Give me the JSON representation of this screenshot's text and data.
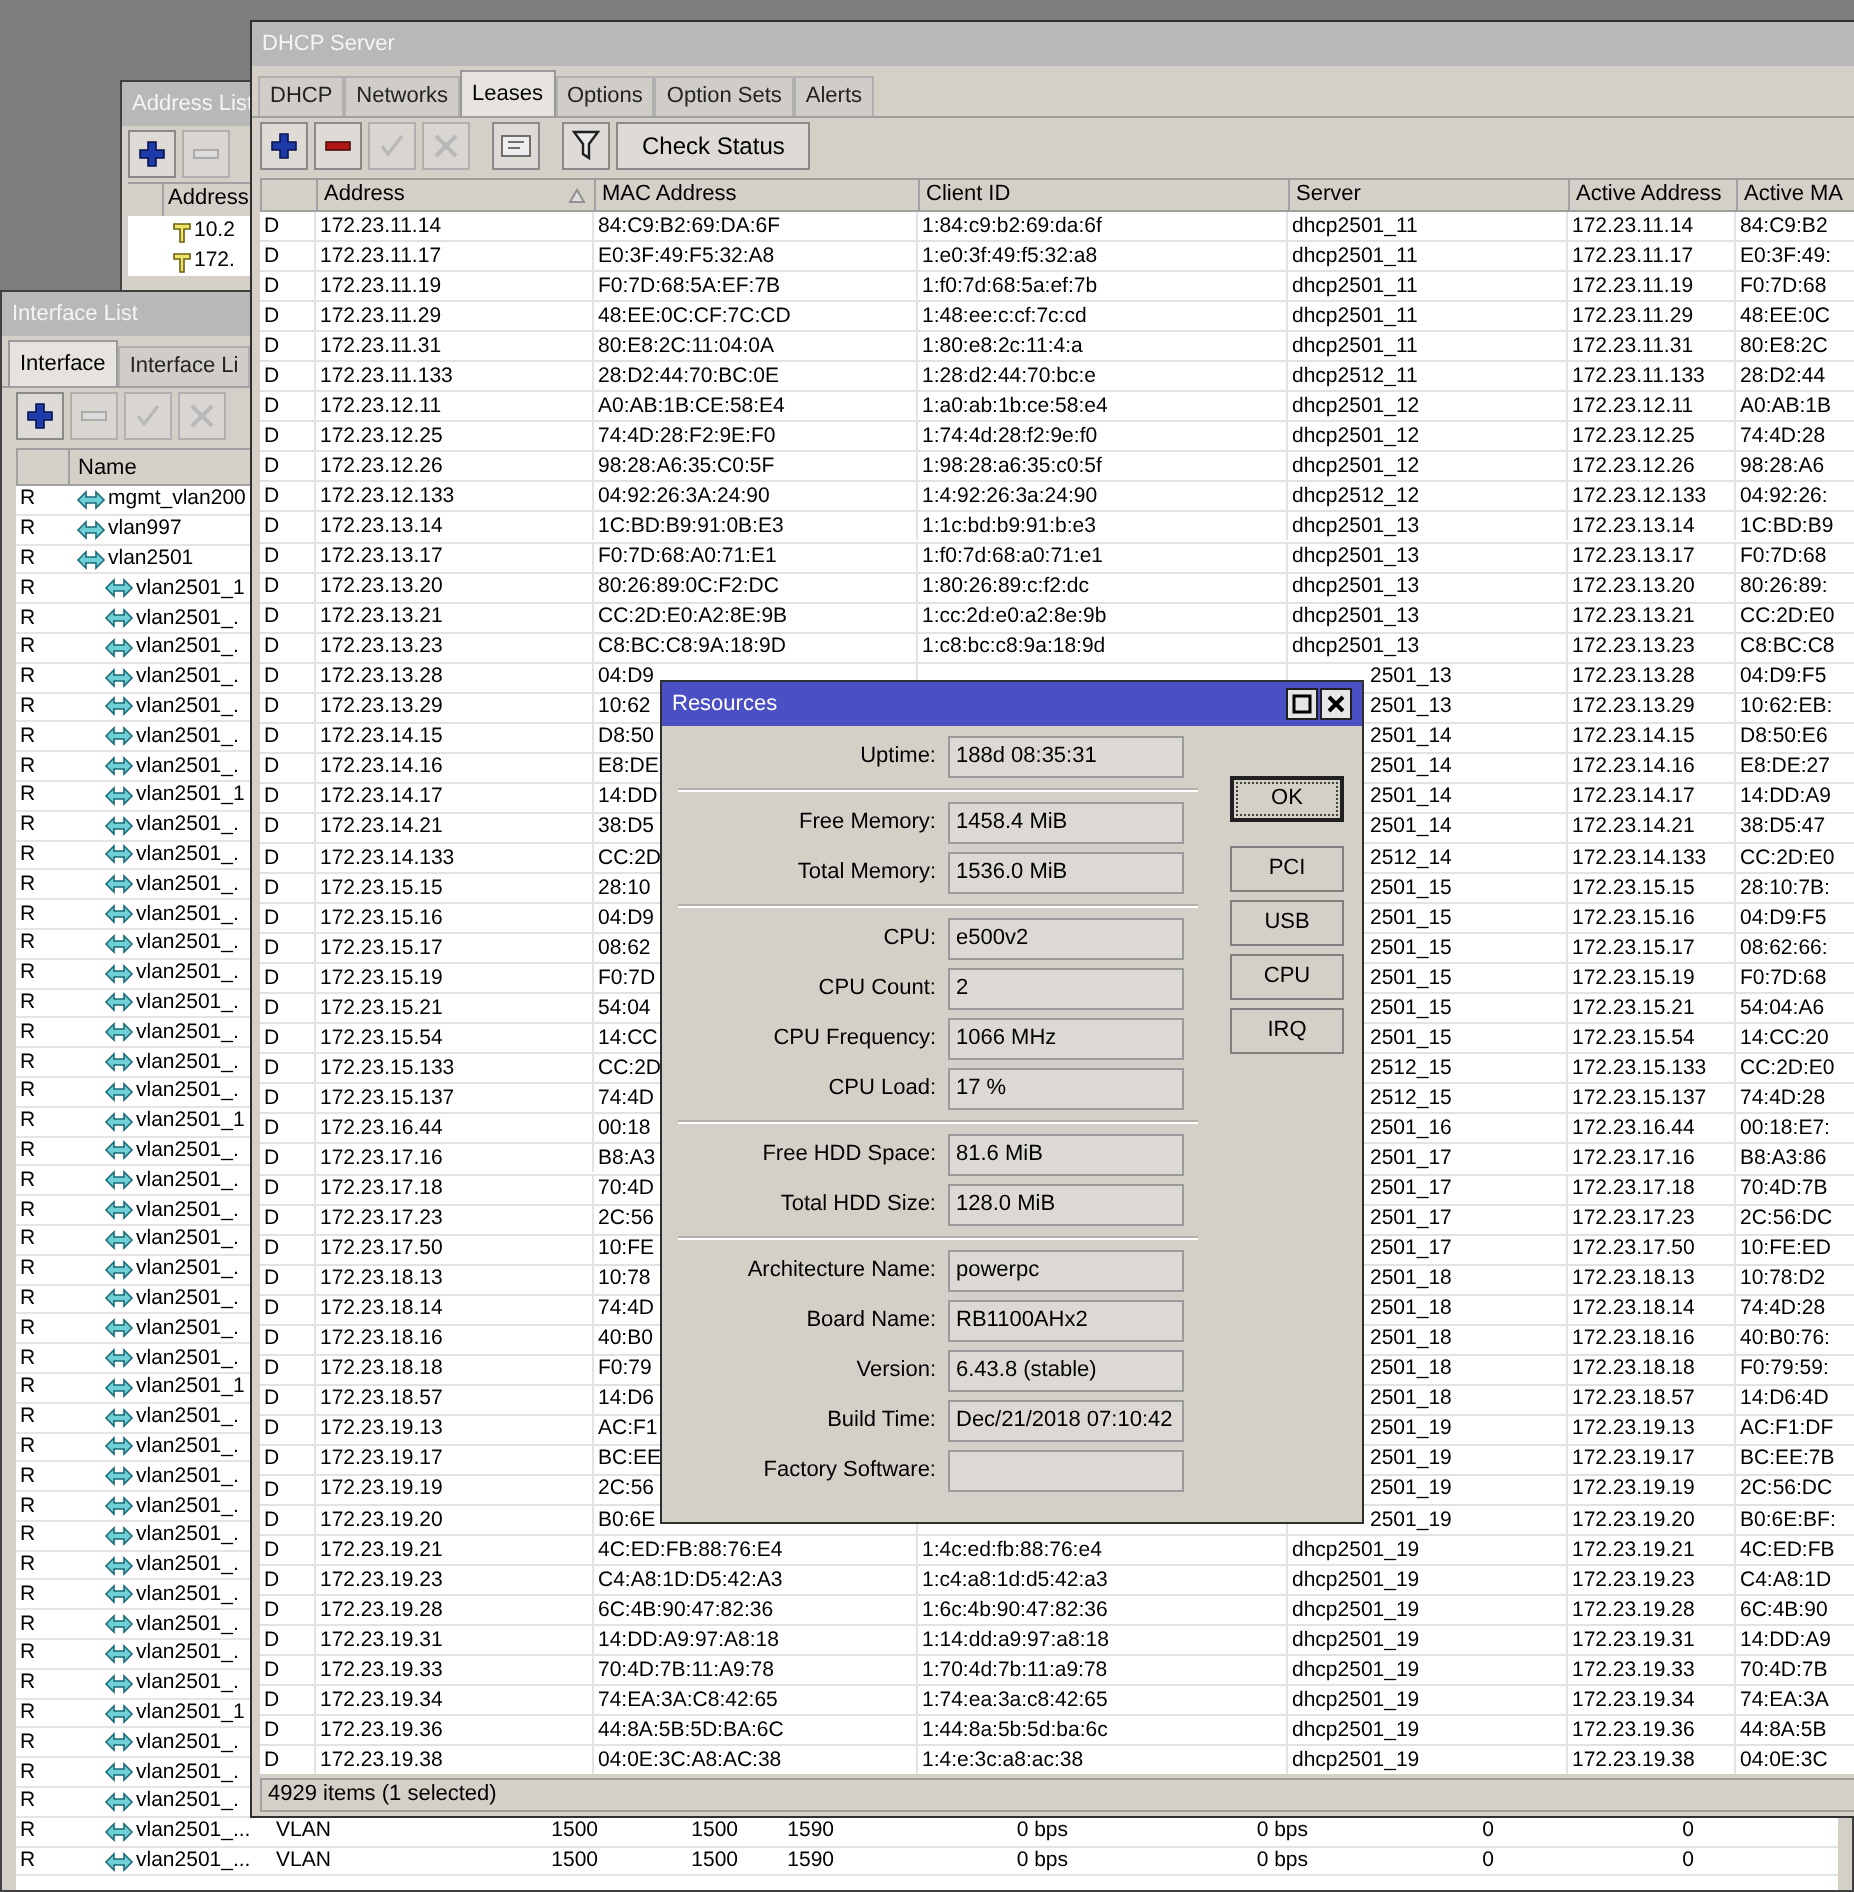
{
  "address_list_window": {
    "title": "Address List",
    "toolbar": [
      {
        "kind": "add",
        "disabled": false
      },
      {
        "kind": "remove",
        "disabled": true
      }
    ],
    "columns": [
      "Address"
    ],
    "rows": [
      "10.2",
      "172."
    ]
  },
  "interface_list_window": {
    "title": "Interface List",
    "tabs": [
      {
        "label": "Interface",
        "selected": true
      },
      {
        "label": "Interface Li",
        "selected": false
      }
    ],
    "toolbar": [
      {
        "kind": "add",
        "disabled": false
      },
      {
        "kind": "remove",
        "disabled": true
      },
      {
        "kind": "enable",
        "disabled": true
      },
      {
        "kind": "disable",
        "disabled": true
      }
    ],
    "columns": [
      "Name"
    ],
    "rows": [
      {
        "flag": "R",
        "name": "mgmt_vlan200"
      },
      {
        "flag": "R",
        "name": "vlan997"
      },
      {
        "flag": "R",
        "name": "vlan2501",
        "children": [
          {
            "flag": "R",
            "name": "vlan2501_1"
          },
          {
            "flag": "R",
            "name": "vlan2501_."
          },
          {
            "flag": "R",
            "name": "vlan2501_."
          },
          {
            "flag": "R",
            "name": "vlan2501_."
          },
          {
            "flag": "R",
            "name": "vlan2501_."
          },
          {
            "flag": "R",
            "name": "vlan2501_."
          },
          {
            "flag": "R",
            "name": "vlan2501_."
          },
          {
            "flag": "R",
            "name": "vlan2501_1"
          },
          {
            "flag": "R",
            "name": "vlan2501_."
          },
          {
            "flag": "R",
            "name": "vlan2501_."
          },
          {
            "flag": "R",
            "name": "vlan2501_."
          },
          {
            "flag": "R",
            "name": "vlan2501_."
          },
          {
            "flag": "R",
            "name": "vlan2501_."
          },
          {
            "flag": "R",
            "name": "vlan2501_."
          },
          {
            "flag": "R",
            "name": "vlan2501_."
          },
          {
            "flag": "R",
            "name": "vlan2501_."
          },
          {
            "flag": "R",
            "name": "vlan2501_."
          },
          {
            "flag": "R",
            "name": "vlan2501_."
          },
          {
            "flag": "R",
            "name": "vlan2501_1"
          },
          {
            "flag": "R",
            "name": "vlan2501_."
          },
          {
            "flag": "R",
            "name": "vlan2501_."
          },
          {
            "flag": "R",
            "name": "vlan2501_."
          },
          {
            "flag": "R",
            "name": "vlan2501_."
          },
          {
            "flag": "R",
            "name": "vlan2501_."
          },
          {
            "flag": "R",
            "name": "vlan2501_."
          },
          {
            "flag": "R",
            "name": "vlan2501_."
          },
          {
            "flag": "R",
            "name": "vlan2501_."
          },
          {
            "flag": "R",
            "name": "vlan2501_1"
          },
          {
            "flag": "R",
            "name": "vlan2501_."
          },
          {
            "flag": "R",
            "name": "vlan2501_."
          },
          {
            "flag": "R",
            "name": "vlan2501_."
          },
          {
            "flag": "R",
            "name": "vlan2501_."
          },
          {
            "flag": "R",
            "name": "vlan2501_."
          },
          {
            "flag": "R",
            "name": "vlan2501_."
          },
          {
            "flag": "R",
            "name": "vlan2501_."
          },
          {
            "flag": "R",
            "name": "vlan2501_."
          },
          {
            "flag": "R",
            "name": "vlan2501_."
          },
          {
            "flag": "R",
            "name": "vlan2501_."
          },
          {
            "flag": "R",
            "name": "vlan2501_1"
          },
          {
            "flag": "R",
            "name": "vlan2501_."
          },
          {
            "flag": "R",
            "name": "vlan2501_."
          },
          {
            "flag": "R",
            "name": "vlan2501_."
          },
          {
            "flag": "R",
            "name": "vlan2501_...",
            "cells": [
              "VLAN",
              "1500",
              "1500",
              "1590",
              "0 bps",
              "0 bps",
              "0",
              "0"
            ]
          },
          {
            "flag": "R",
            "name": "vlan2501_...",
            "cells": [
              "VLAN",
              "1500",
              "1500",
              "1590",
              "0 bps",
              "0 bps",
              "0",
              "0"
            ]
          }
        ]
      }
    ]
  },
  "dhcp_window": {
    "title": "DHCP Server",
    "tabs": [
      {
        "label": "DHCP",
        "selected": false
      },
      {
        "label": "Networks",
        "selected": false
      },
      {
        "label": "Leases",
        "selected": true
      },
      {
        "label": "Options",
        "selected": false
      },
      {
        "label": "Option Sets",
        "selected": false
      },
      {
        "label": "Alerts",
        "selected": false
      }
    ],
    "toolbar": [
      {
        "kind": "add",
        "disabled": false
      },
      {
        "kind": "remove",
        "disabled": false
      },
      {
        "kind": "enable",
        "disabled": true
      },
      {
        "kind": "disable",
        "disabled": true
      },
      {
        "kind": "comment",
        "disabled": false
      },
      {
        "kind": "filter",
        "disabled": false
      },
      {
        "kind": "text",
        "label": "Check Status",
        "disabled": false
      }
    ],
    "columns": [
      {
        "label": "Address",
        "sorted": true
      },
      {
        "label": "MAC Address",
        "sorted": false
      },
      {
        "label": "Client ID",
        "sorted": false
      },
      {
        "label": "Server",
        "sorted": false
      },
      {
        "label": "Active Address",
        "sorted": false
      },
      {
        "label": "Active MA",
        "sorted": false
      }
    ],
    "rows": [
      {
        "kind": "full",
        "flag": "D",
        "address": "172.23.11.14",
        "mac": "84:C9:B2:69:DA:6F",
        "client_id": "1:84:c9:b2:69:da:6f",
        "server": "dhcp2501_11",
        "active_address": "172.23.11.14",
        "active_mac": "84:C9:B2"
      },
      {
        "kind": "full",
        "flag": "D",
        "address": "172.23.11.17",
        "mac": "E0:3F:49:F5:32:A8",
        "client_id": "1:e0:3f:49:f5:32:a8",
        "server": "dhcp2501_11",
        "active_address": "172.23.11.17",
        "active_mac": "E0:3F:49:"
      },
      {
        "kind": "full",
        "flag": "D",
        "address": "172.23.11.19",
        "mac": "F0:7D:68:5A:EF:7B",
        "client_id": "1:f0:7d:68:5a:ef:7b",
        "server": "dhcp2501_11",
        "active_address": "172.23.11.19",
        "active_mac": "F0:7D:68"
      },
      {
        "kind": "full",
        "flag": "D",
        "address": "172.23.11.29",
        "mac": "48:EE:0C:CF:7C:CD",
        "client_id": "1:48:ee:c:cf:7c:cd",
        "server": "dhcp2501_11",
        "active_address": "172.23.11.29",
        "active_mac": "48:EE:0C"
      },
      {
        "kind": "full",
        "flag": "D",
        "address": "172.23.11.31",
        "mac": "80:E8:2C:11:04:0A",
        "client_id": "1:80:e8:2c:11:4:a",
        "server": "dhcp2501_11",
        "active_address": "172.23.11.31",
        "active_mac": "80:E8:2C"
      },
      {
        "kind": "full",
        "flag": "D",
        "address": "172.23.11.133",
        "mac": "28:D2:44:70:BC:0E",
        "client_id": "1:28:d2:44:70:bc:e",
        "server": "dhcp2512_11",
        "active_address": "172.23.11.133",
        "active_mac": "28:D2:44"
      },
      {
        "kind": "full",
        "flag": "D",
        "address": "172.23.12.11",
        "mac": "A0:AB:1B:CE:58:E4",
        "client_id": "1:a0:ab:1b:ce:58:e4",
        "server": "dhcp2501_12",
        "active_address": "172.23.12.11",
        "active_mac": "A0:AB:1B"
      },
      {
        "kind": "full",
        "flag": "D",
        "address": "172.23.12.25",
        "mac": "74:4D:28:F2:9E:F0",
        "client_id": "1:74:4d:28:f2:9e:f0",
        "server": "dhcp2501_12",
        "active_address": "172.23.12.25",
        "active_mac": "74:4D:28"
      },
      {
        "kind": "full",
        "flag": "D",
        "address": "172.23.12.26",
        "mac": "98:28:A6:35:C0:5F",
        "client_id": "1:98:28:a6:35:c0:5f",
        "server": "dhcp2501_12",
        "active_address": "172.23.12.26",
        "active_mac": "98:28:A6"
      },
      {
        "kind": "full",
        "flag": "D",
        "address": "172.23.12.133",
        "mac": "04:92:26:3A:24:90",
        "client_id": "1:4:92:26:3a:24:90",
        "server": "dhcp2512_12",
        "active_address": "172.23.12.133",
        "active_mac": "04:92:26:"
      },
      {
        "kind": "full",
        "flag": "D",
        "address": "172.23.13.14",
        "mac": "1C:BD:B9:91:0B:E3",
        "client_id": "1:1c:bd:b9:91:b:e3",
        "server": "dhcp2501_13",
        "active_address": "172.23.13.14",
        "active_mac": "1C:BD:B9"
      },
      {
        "kind": "full",
        "flag": "D",
        "address": "172.23.13.17",
        "mac": "F0:7D:68:A0:71:E1",
        "client_id": "1:f0:7d:68:a0:71:e1",
        "server": "dhcp2501_13",
        "active_address": "172.23.13.17",
        "active_mac": "F0:7D:68"
      },
      {
        "kind": "full",
        "flag": "D",
        "address": "172.23.13.20",
        "mac": "80:26:89:0C:F2:DC",
        "client_id": "1:80:26:89:c:f2:dc",
        "server": "dhcp2501_13",
        "active_address": "172.23.13.20",
        "active_mac": "80:26:89:"
      },
      {
        "kind": "full",
        "flag": "D",
        "address": "172.23.13.21",
        "mac": "CC:2D:E0:A2:8E:9B",
        "client_id": "1:cc:2d:e0:a2:8e:9b",
        "server": "dhcp2501_13",
        "active_address": "172.23.13.21",
        "active_mac": "CC:2D:E0"
      },
      {
        "kind": "full",
        "flag": "D",
        "address": "172.23.13.23",
        "mac": "C8:BC:C8:9A:18:9D",
        "client_id": "1:c8:bc:c8:9a:18:9d",
        "server": "dhcp2501_13",
        "active_address": "172.23.13.23",
        "active_mac": "C8:BC:C8"
      },
      {
        "kind": "covered",
        "flag": "D",
        "address": "172.23.13.28",
        "mac": "04:D9",
        "server": "2501_13",
        "active_address": "172.23.13.28",
        "active_mac": "04:D9:F5"
      },
      {
        "kind": "covered",
        "flag": "D",
        "address": "172.23.13.29",
        "mac": "10:62",
        "server": "2501_13",
        "active_address": "172.23.13.29",
        "active_mac": "10:62:EB:"
      },
      {
        "kind": "covered",
        "flag": "D",
        "address": "172.23.14.15",
        "mac": "D8:50",
        "server": "2501_14",
        "active_address": "172.23.14.15",
        "active_mac": "D8:50:E6"
      },
      {
        "kind": "covered",
        "flag": "D",
        "address": "172.23.14.16",
        "mac": "E8:DE",
        "server": "2501_14",
        "active_address": "172.23.14.16",
        "active_mac": "E8:DE:27"
      },
      {
        "kind": "covered",
        "flag": "D",
        "address": "172.23.14.17",
        "mac": "14:DD",
        "server": "2501_14",
        "active_address": "172.23.14.17",
        "active_mac": "14:DD:A9"
      },
      {
        "kind": "covered",
        "flag": "D",
        "address": "172.23.14.21",
        "mac": "38:D5",
        "server": "2501_14",
        "active_address": "172.23.14.21",
        "active_mac": "38:D5:47"
      },
      {
        "kind": "covered",
        "flag": "D",
        "address": "172.23.14.133",
        "mac": "CC:2D",
        "server": "2512_14",
        "active_address": "172.23.14.133",
        "active_mac": "CC:2D:E0"
      },
      {
        "kind": "covered",
        "flag": "D",
        "address": "172.23.15.15",
        "mac": "28:10",
        "server": "2501_15",
        "active_address": "172.23.15.15",
        "active_mac": "28:10:7B:"
      },
      {
        "kind": "covered",
        "flag": "D",
        "address": "172.23.15.16",
        "mac": "04:D9",
        "server": "2501_15",
        "active_address": "172.23.15.16",
        "active_mac": "04:D9:F5"
      },
      {
        "kind": "covered",
        "flag": "D",
        "address": "172.23.15.17",
        "mac": "08:62",
        "server": "2501_15",
        "active_address": "172.23.15.17",
        "active_mac": "08:62:66:"
      },
      {
        "kind": "covered",
        "flag": "D",
        "address": "172.23.15.19",
        "mac": "F0:7D",
        "server": "2501_15",
        "active_address": "172.23.15.19",
        "active_mac": "F0:7D:68"
      },
      {
        "kind": "covered",
        "flag": "D",
        "address": "172.23.15.21",
        "mac": "54:04",
        "server": "2501_15",
        "active_address": "172.23.15.21",
        "active_mac": "54:04:A6"
      },
      {
        "kind": "covered",
        "flag": "D",
        "address": "172.23.15.54",
        "mac": "14:CC",
        "server": "2501_15",
        "active_address": "172.23.15.54",
        "active_mac": "14:CC:20"
      },
      {
        "kind": "covered",
        "flag": "D",
        "address": "172.23.15.133",
        "mac": "CC:2D",
        "server": "2512_15",
        "active_address": "172.23.15.133",
        "active_mac": "CC:2D:E0"
      },
      {
        "kind": "covered",
        "flag": "D",
        "address": "172.23.15.137",
        "mac": "74:4D",
        "server": "2512_15",
        "active_address": "172.23.15.137",
        "active_mac": "74:4D:28"
      },
      {
        "kind": "covered",
        "flag": "D",
        "address": "172.23.16.44",
        "mac": "00:18",
        "server": "2501_16",
        "active_address": "172.23.16.44",
        "active_mac": "00:18:E7:"
      },
      {
        "kind": "covered",
        "flag": "D",
        "address": "172.23.17.16",
        "mac": "B8:A3",
        "server": "2501_17",
        "active_address": "172.23.17.16",
        "active_mac": "B8:A3:86"
      },
      {
        "kind": "covered",
        "flag": "D",
        "address": "172.23.17.18",
        "mac": "70:4D",
        "server": "2501_17",
        "active_address": "172.23.17.18",
        "active_mac": "70:4D:7B"
      },
      {
        "kind": "covered",
        "flag": "D",
        "address": "172.23.17.23",
        "mac": "2C:56",
        "server": "2501_17",
        "active_address": "172.23.17.23",
        "active_mac": "2C:56:DC"
      },
      {
        "kind": "covered",
        "flag": "D",
        "address": "172.23.17.50",
        "mac": "10:FE",
        "server": "2501_17",
        "active_address": "172.23.17.50",
        "active_mac": "10:FE:ED"
      },
      {
        "kind": "covered",
        "flag": "D",
        "address": "172.23.18.13",
        "mac": "10:78",
        "server": "2501_18",
        "active_address": "172.23.18.13",
        "active_mac": "10:78:D2"
      },
      {
        "kind": "covered",
        "flag": "D",
        "address": "172.23.18.14",
        "mac": "74:4D",
        "server": "2501_18",
        "active_address": "172.23.18.14",
        "active_mac": "74:4D:28"
      },
      {
        "kind": "covered",
        "flag": "D",
        "address": "172.23.18.16",
        "mac": "40:B0",
        "server": "2501_18",
        "active_address": "172.23.18.16",
        "active_mac": "40:B0:76:"
      },
      {
        "kind": "covered",
        "flag": "D",
        "address": "172.23.18.18",
        "mac": "F0:79",
        "server": "2501_18",
        "active_address": "172.23.18.18",
        "active_mac": "F0:79:59:"
      },
      {
        "kind": "covered",
        "flag": "D",
        "address": "172.23.18.57",
        "mac": "14:D6",
        "server": "2501_18",
        "active_address": "172.23.18.57",
        "active_mac": "14:D6:4D"
      },
      {
        "kind": "covered",
        "flag": "D",
        "address": "172.23.19.13",
        "mac": "AC:F1",
        "server": "2501_19",
        "active_address": "172.23.19.13",
        "active_mac": "AC:F1:DF"
      },
      {
        "kind": "covered",
        "flag": "D",
        "address": "172.23.19.17",
        "mac": "BC:EE",
        "server": "2501_19",
        "active_address": "172.23.19.17",
        "active_mac": "BC:EE:7B"
      },
      {
        "kind": "covered",
        "flag": "D",
        "address": "172.23.19.19",
        "mac": "2C:56",
        "server": "2501_19",
        "active_address": "172.23.19.19",
        "active_mac": "2C:56:DC"
      },
      {
        "kind": "covered",
        "flag": "D",
        "address": "172.23.19.20",
        "mac": "B0:6E",
        "server": "2501_19",
        "active_address": "172.23.19.20",
        "active_mac": "B0:6E:BF:"
      },
      {
        "kind": "full",
        "flag": "D",
        "address": "172.23.19.21",
        "mac": "4C:ED:FB:88:76:E4",
        "client_id": "1:4c:ed:fb:88:76:e4",
        "server": "dhcp2501_19",
        "active_address": "172.23.19.21",
        "active_mac": "4C:ED:FB"
      },
      {
        "kind": "full",
        "flag": "D",
        "address": "172.23.19.23",
        "mac": "C4:A8:1D:D5:42:A3",
        "client_id": "1:c4:a8:1d:d5:42:a3",
        "server": "dhcp2501_19",
        "active_address": "172.23.19.23",
        "active_mac": "C4:A8:1D"
      },
      {
        "kind": "full",
        "flag": "D",
        "address": "172.23.19.28",
        "mac": "6C:4B:90:47:82:36",
        "client_id": "1:6c:4b:90:47:82:36",
        "server": "dhcp2501_19",
        "active_address": "172.23.19.28",
        "active_mac": "6C:4B:90"
      },
      {
        "kind": "full",
        "flag": "D",
        "address": "172.23.19.31",
        "mac": "14:DD:A9:97:A8:18",
        "client_id": "1:14:dd:a9:97:a8:18",
        "server": "dhcp2501_19",
        "active_address": "172.23.19.31",
        "active_mac": "14:DD:A9"
      },
      {
        "kind": "full",
        "flag": "D",
        "address": "172.23.19.33",
        "mac": "70:4D:7B:11:A9:78",
        "client_id": "1:70:4d:7b:11:a9:78",
        "server": "dhcp2501_19",
        "active_address": "172.23.19.33",
        "active_mac": "70:4D:7B"
      },
      {
        "kind": "full",
        "flag": "D",
        "address": "172.23.19.34",
        "mac": "74:EA:3A:C8:42:65",
        "client_id": "1:74:ea:3a:c8:42:65",
        "server": "dhcp2501_19",
        "active_address": "172.23.19.34",
        "active_mac": "74:EA:3A"
      },
      {
        "kind": "full",
        "flag": "D",
        "address": "172.23.19.36",
        "mac": "44:8A:5B:5D:BA:6C",
        "client_id": "1:44:8a:5b:5d:ba:6c",
        "server": "dhcp2501_19",
        "active_address": "172.23.19.36",
        "active_mac": "44:8A:5B"
      },
      {
        "kind": "full",
        "flag": "D",
        "address": "172.23.19.38",
        "mac": "04:0E:3C:A8:AC:38",
        "client_id": "1:4:e:3c:a8:ac:38",
        "server": "dhcp2501_19",
        "active_address": "172.23.19.38",
        "active_mac": "04:0E:3C"
      }
    ],
    "status": "4929 items (1 selected)"
  },
  "resources_dialog": {
    "title": "Resources",
    "fields": [
      {
        "label": "Uptime:",
        "value": "188d 08:35:31",
        "separator_before": false
      },
      {
        "label": "Free Memory:",
        "value": "1458.4 MiB",
        "separator_before": true
      },
      {
        "label": "Total Memory:",
        "value": "1536.0 MiB",
        "separator_before": false
      },
      {
        "label": "CPU:",
        "value": "e500v2",
        "separator_before": true
      },
      {
        "label": "CPU Count:",
        "value": "2",
        "separator_before": false
      },
      {
        "label": "CPU Frequency:",
        "value": "1066 MHz",
        "separator_before": false
      },
      {
        "label": "CPU Load:",
        "value": "17 %",
        "separator_before": false
      },
      {
        "label": "Free HDD Space:",
        "value": "81.6 MiB",
        "separator_before": true
      },
      {
        "label": "Total HDD Size:",
        "value": "128.0 MiB",
        "separator_before": false
      },
      {
        "label": "Architecture Name:",
        "value": "powerpc",
        "separator_before": true
      },
      {
        "label": "Board Name:",
        "value": "RB1100AHx2",
        "separator_before": false
      },
      {
        "label": "Version:",
        "value": "6.43.8 (stable)",
        "separator_before": false
      },
      {
        "label": "Build Time:",
        "value": "Dec/21/2018 07:10:42",
        "separator_before": false
      },
      {
        "label": "Factory Software:",
        "separator_before": false
      }
    ],
    "buttons": [
      {
        "label": "OK",
        "focused": true
      },
      {
        "label": "PCI",
        "focused": false
      },
      {
        "label": "USB",
        "focused": false
      },
      {
        "label": "CPU",
        "focused": false
      },
      {
        "label": "IRQ",
        "focused": false
      }
    ]
  }
}
